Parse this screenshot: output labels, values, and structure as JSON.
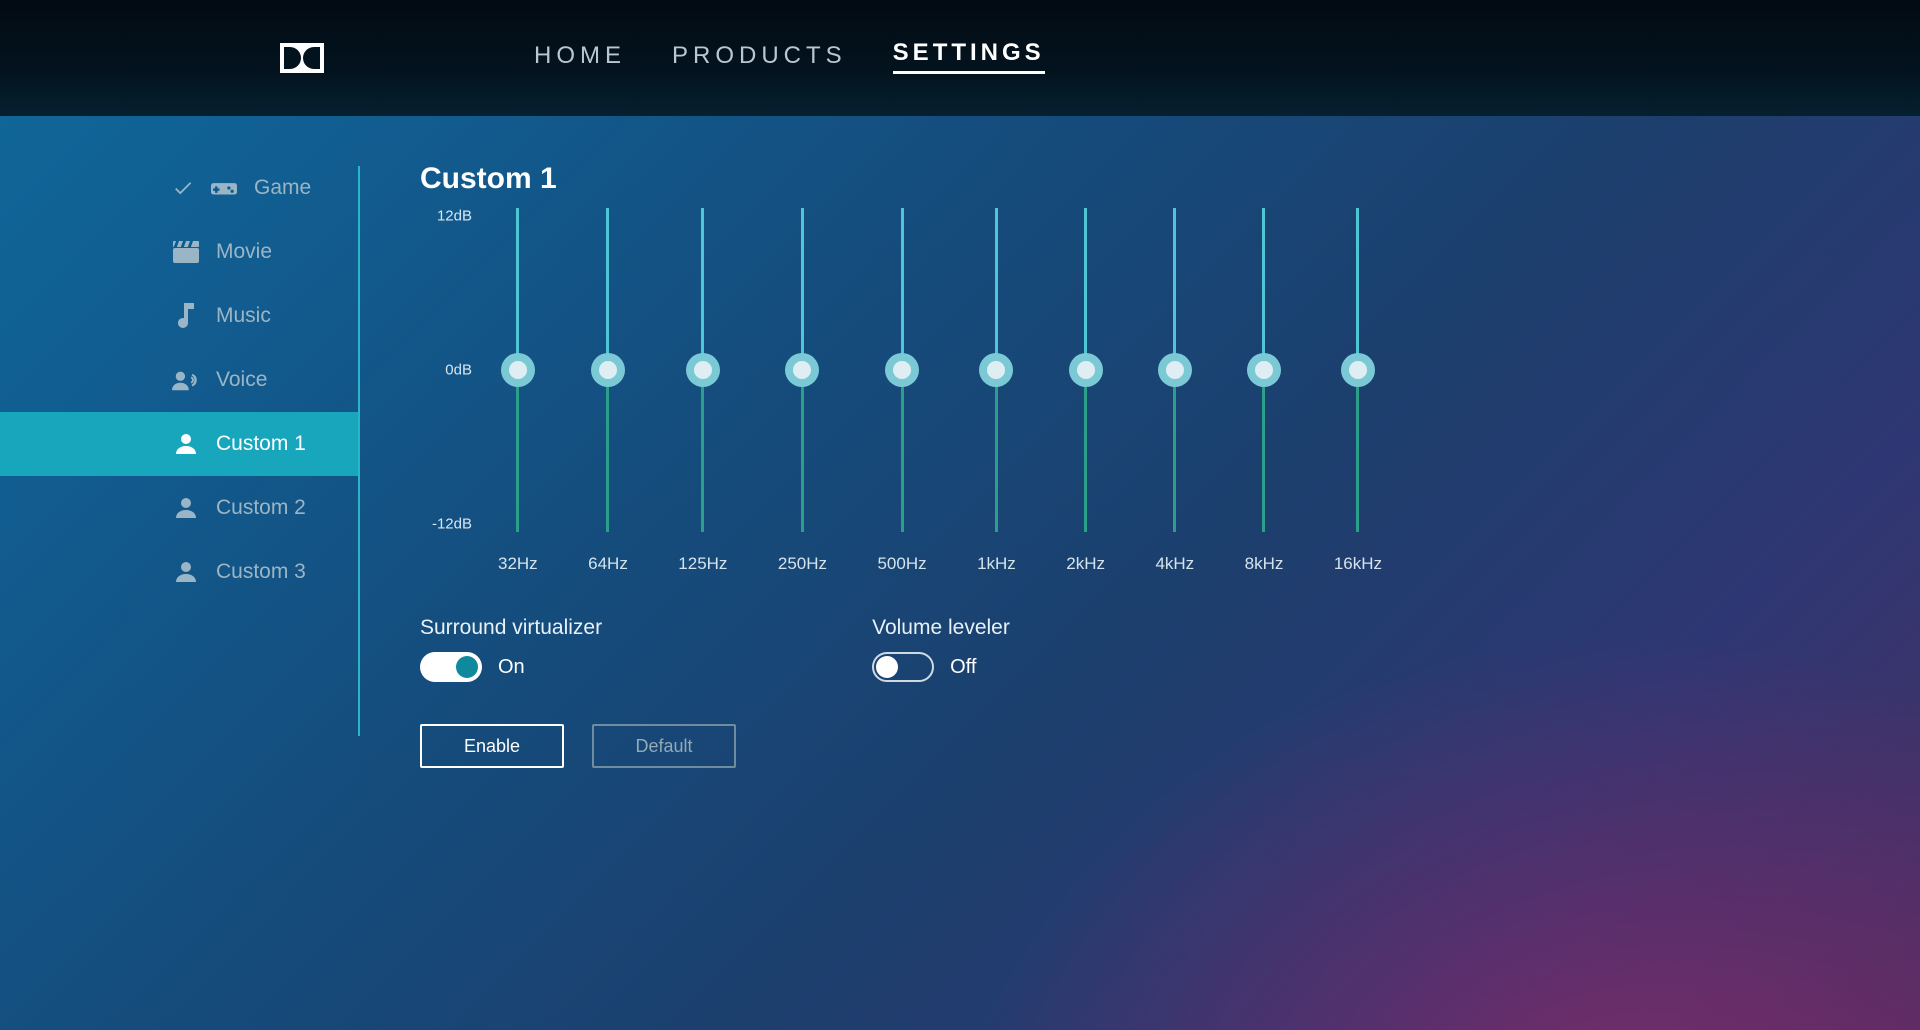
{
  "nav": {
    "items": [
      {
        "label": "HOME",
        "active": false
      },
      {
        "label": "PRODUCTS",
        "active": false
      },
      {
        "label": "SETTINGS",
        "active": true
      }
    ]
  },
  "sidebar": {
    "items": [
      {
        "icon": "gamepad-icon",
        "label": "Game",
        "selected": false,
        "checked": true
      },
      {
        "icon": "clapper-icon",
        "label": "Movie",
        "selected": false,
        "checked": false
      },
      {
        "icon": "music-note-icon",
        "label": "Music",
        "selected": false,
        "checked": false
      },
      {
        "icon": "voice-icon",
        "label": "Voice",
        "selected": false,
        "checked": false
      },
      {
        "icon": "person-icon",
        "label": "Custom 1",
        "selected": true,
        "checked": false
      },
      {
        "icon": "person-icon",
        "label": "Custom 2",
        "selected": false,
        "checked": false
      },
      {
        "icon": "person-icon",
        "label": "Custom 3",
        "selected": false,
        "checked": false
      }
    ]
  },
  "panel": {
    "title": "Custom 1",
    "eq": {
      "y_top": "12dB",
      "y_mid": "0dB",
      "y_bot": "-12dB",
      "bands": [
        {
          "freq": "32Hz",
          "value": 0
        },
        {
          "freq": "64Hz",
          "value": 0
        },
        {
          "freq": "125Hz",
          "value": 0
        },
        {
          "freq": "250Hz",
          "value": 0
        },
        {
          "freq": "500Hz",
          "value": 0
        },
        {
          "freq": "1kHz",
          "value": 0
        },
        {
          "freq": "2kHz",
          "value": 0
        },
        {
          "freq": "4kHz",
          "value": 0
        },
        {
          "freq": "8kHz",
          "value": 0
        },
        {
          "freq": "16kHz",
          "value": 0
        }
      ],
      "range_db": 12
    },
    "surround": {
      "label": "Surround virtualizer",
      "on": true,
      "state_label": "On"
    },
    "leveler": {
      "label": "Volume leveler",
      "on": false,
      "state_label": "Off"
    },
    "buttons": {
      "enable": "Enable",
      "default": "Default"
    }
  }
}
